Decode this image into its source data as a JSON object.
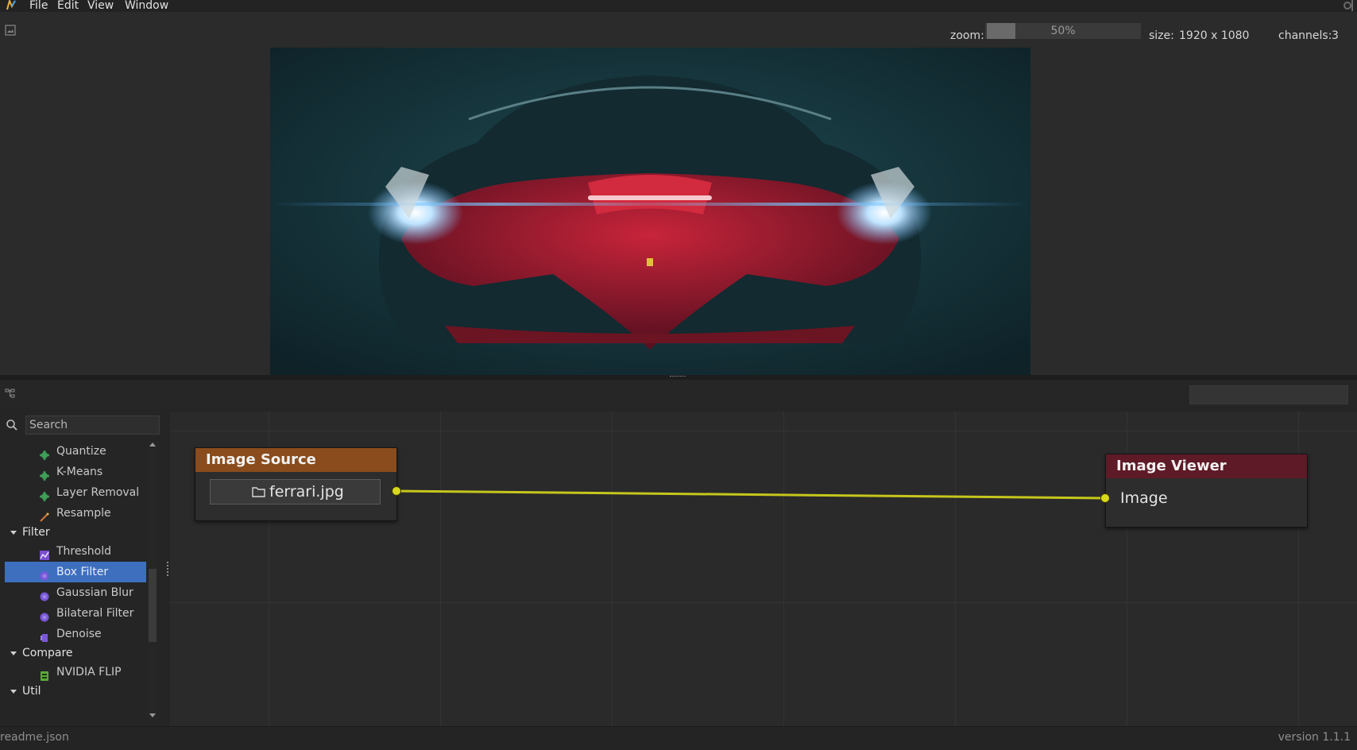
{
  "menubar": {
    "items": [
      "File",
      "Edit",
      "View",
      "Window"
    ]
  },
  "viewer": {
    "zoom_label": "zoom:",
    "zoom_value": "50%",
    "zoom_fraction": 0.5,
    "size_label": "size:",
    "size_value": "1920 x 1080",
    "channels_label": "channels:",
    "channels_value": "3"
  },
  "sidebar": {
    "search_placeholder": "Search",
    "items": [
      {
        "kind": "item",
        "label": "Quantize",
        "icon": "cluster-icon",
        "color": "#3f9f58"
      },
      {
        "kind": "item",
        "label": "K-Means",
        "icon": "cluster-icon",
        "color": "#3f9f58"
      },
      {
        "kind": "item",
        "label": "Layer Removal",
        "icon": "cluster-icon",
        "color": "#3f9f58"
      },
      {
        "kind": "item",
        "label": "Resample",
        "icon": "wand-icon",
        "color": "#d07a3a"
      },
      {
        "kind": "category",
        "label": "Filter"
      },
      {
        "kind": "item",
        "label": "Threshold",
        "icon": "threshold-icon",
        "color": "#7b4fd0"
      },
      {
        "kind": "item",
        "label": "Box Filter",
        "icon": "blur-icon",
        "color": "#7b57d8",
        "selected": true
      },
      {
        "kind": "item",
        "label": "Gaussian Blur",
        "icon": "blur-icon",
        "color": "#7b57d8"
      },
      {
        "kind": "item",
        "label": "Bilateral Filter",
        "icon": "blur-icon",
        "color": "#7b57d8"
      },
      {
        "kind": "item",
        "label": "Denoise",
        "icon": "denoise-icon",
        "color": "#7b57d8"
      },
      {
        "kind": "category",
        "label": "Compare"
      },
      {
        "kind": "item",
        "label": "NVIDIA FLIP",
        "icon": "flip-icon",
        "color": "#5aa83a"
      },
      {
        "kind": "category",
        "label": "Util"
      }
    ]
  },
  "nodes": {
    "source": {
      "title": "Image Source",
      "file": "ferrari.jpg"
    },
    "viewer": {
      "title": "Image Viewer",
      "port": "Image"
    }
  },
  "colors": {
    "connection": "#c6c61c",
    "source_header": "#8a4c1c",
    "viewer_header": "#5e1a26",
    "selection": "#3e6fbf"
  },
  "statusbar": {
    "left": "readme.json",
    "right": "version 1.1.1"
  }
}
